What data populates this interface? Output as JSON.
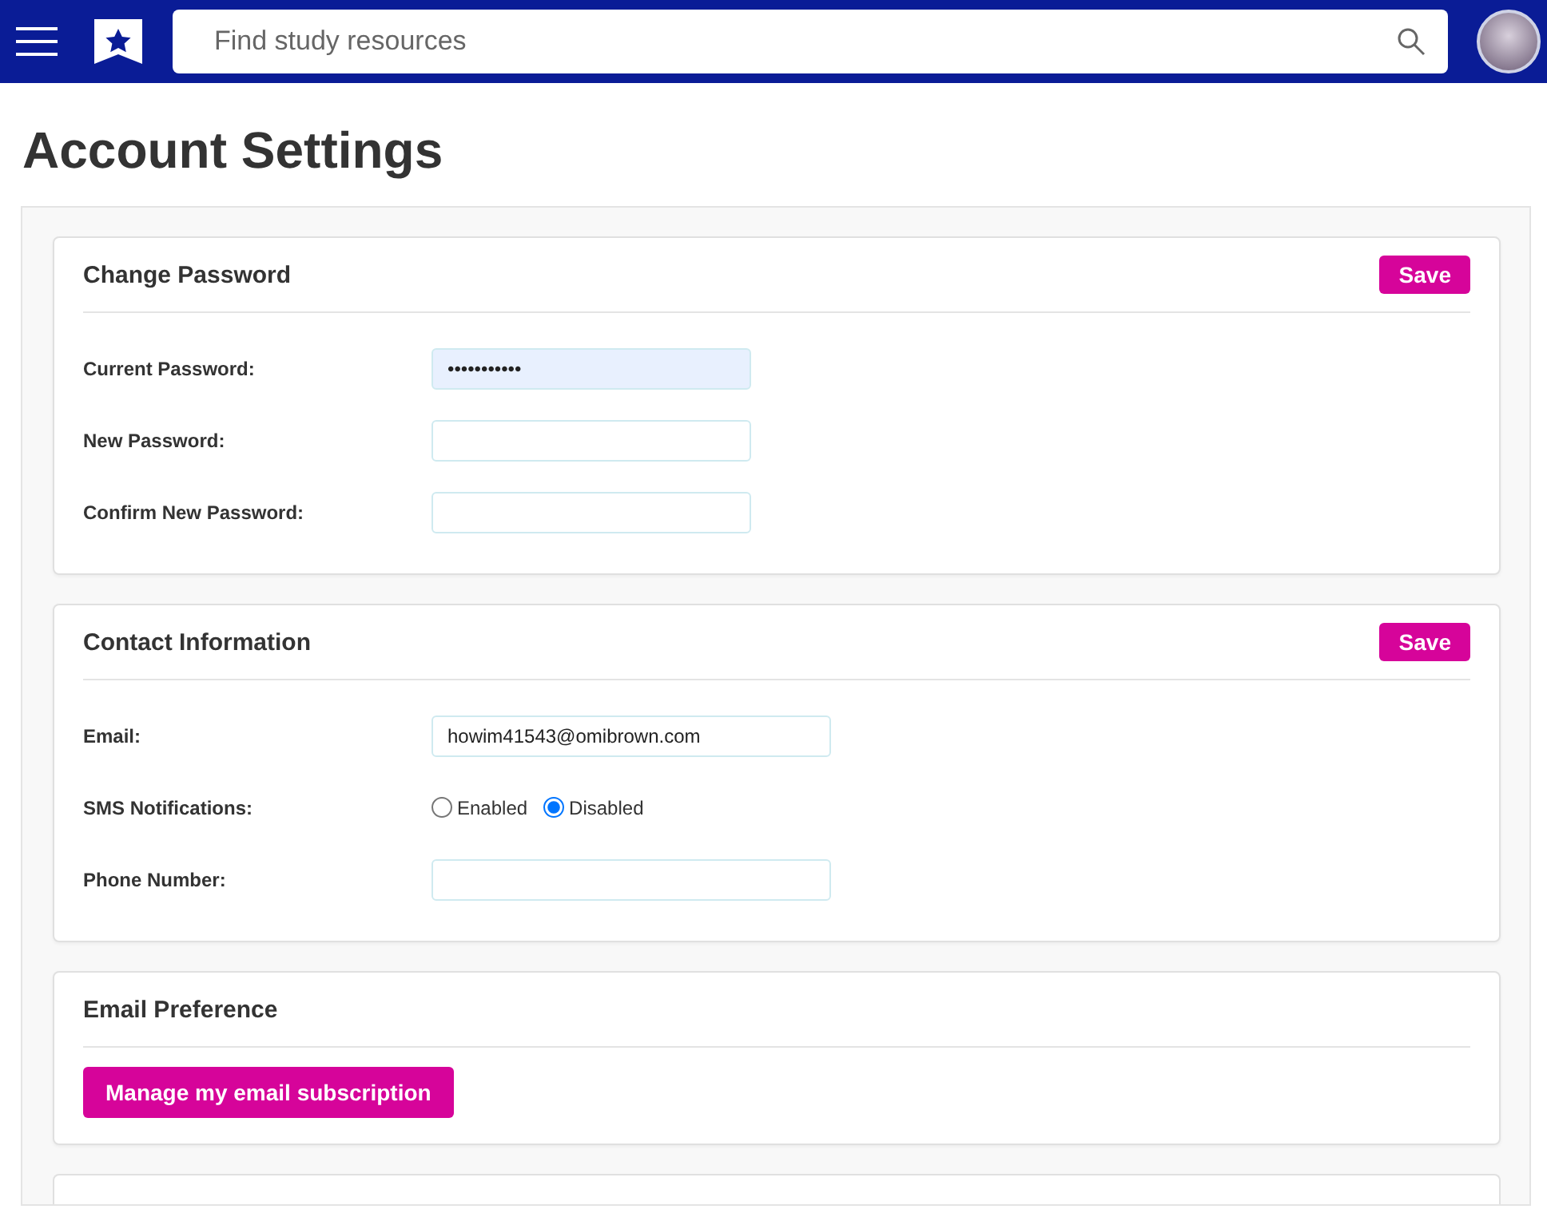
{
  "header": {
    "search": {
      "placeholder": "Find study resources"
    }
  },
  "page_title": "Account Settings",
  "sections": [
    {
      "title": "Change Password",
      "save_label": "Save",
      "fields": [
        {
          "kind": "input",
          "label": "Current Password:",
          "value": "•••••••••••",
          "autofilled": true,
          "wide": false
        },
        {
          "kind": "input",
          "label": "New Password:",
          "autofilled": false,
          "wide": false
        },
        {
          "kind": "input",
          "label": "Confirm New Password:",
          "autofilled": false,
          "wide": false
        }
      ]
    },
    {
      "title": "Contact Information",
      "save_label": "Save",
      "fields": [
        {
          "kind": "input",
          "label": "Email:",
          "value": "howim41543@omibrown.com",
          "autofilled": false,
          "wide": true
        },
        {
          "kind": "radio",
          "label": "SMS Notifications:",
          "options": [
            {
              "label": "Enabled",
              "selected": false
            },
            {
              "label": "Disabled",
              "selected": true
            }
          ]
        },
        {
          "kind": "input",
          "label": "Phone Number:",
          "autofilled": false,
          "wide": true
        }
      ]
    },
    {
      "title": "Email Preference",
      "action_label": "Manage my email subscription"
    }
  ]
}
